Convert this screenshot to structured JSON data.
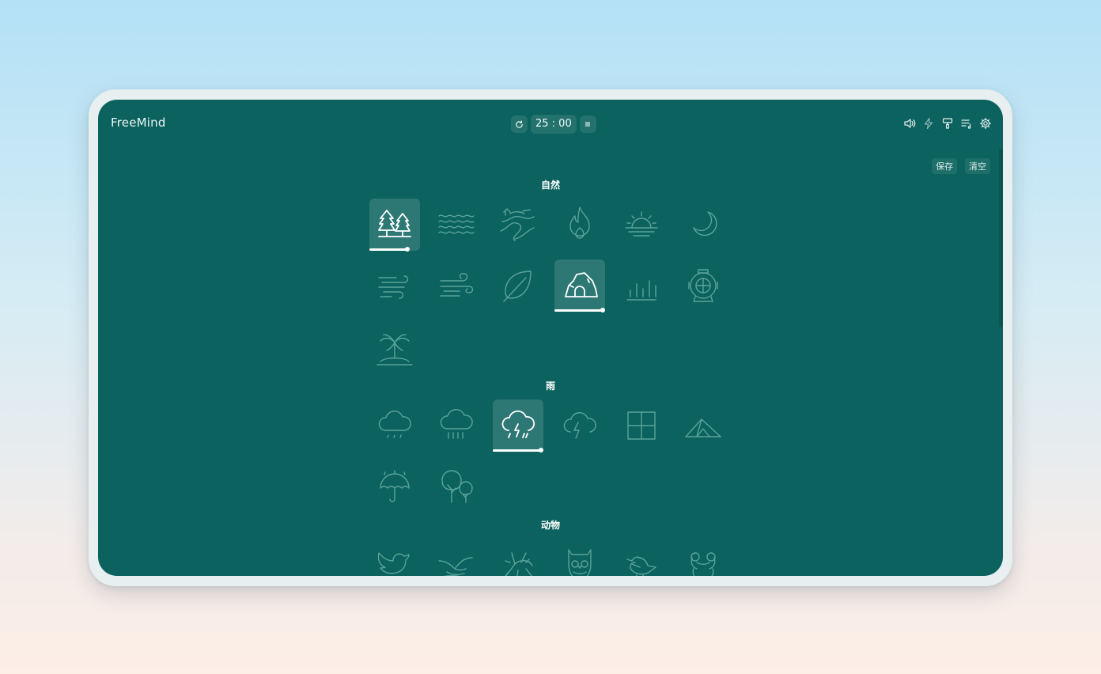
{
  "app": {
    "title": "FreeMind"
  },
  "timer": {
    "display": "25 : 00"
  },
  "actions": {
    "save": "保存",
    "clear": "清空"
  },
  "sections": [
    {
      "title": "自然",
      "sounds": [
        {
          "icon": "forest-icon",
          "active": true,
          "volume": 0.75
        },
        {
          "icon": "waves-icon",
          "active": false
        },
        {
          "icon": "river-icon",
          "active": false
        },
        {
          "icon": "fire-icon",
          "active": false
        },
        {
          "icon": "sunset-icon",
          "active": false
        },
        {
          "icon": "moon-icon",
          "active": false
        },
        {
          "icon": "breeze-icon",
          "active": false
        },
        {
          "icon": "wind-icon",
          "active": false
        },
        {
          "icon": "leaf-icon",
          "active": false
        },
        {
          "icon": "cave-icon",
          "active": true,
          "volume": 0.95
        },
        {
          "icon": "drips-icon",
          "active": false
        },
        {
          "icon": "diving-helmet-icon",
          "active": false
        },
        {
          "icon": "island-icon",
          "active": false
        }
      ]
    },
    {
      "title": "雨",
      "sounds": [
        {
          "icon": "light-rain-icon",
          "active": false
        },
        {
          "icon": "heavy-rain-icon",
          "active": false
        },
        {
          "icon": "thunderstorm-icon",
          "active": true,
          "volume": 0.95
        },
        {
          "icon": "thunder-icon",
          "active": false
        },
        {
          "icon": "window-icon",
          "active": false
        },
        {
          "icon": "tent-icon",
          "active": false
        },
        {
          "icon": "umbrella-icon",
          "active": false
        },
        {
          "icon": "rain-on-trees-icon",
          "active": false
        }
      ]
    },
    {
      "title": "动物",
      "sounds": [
        {
          "icon": "bird-icon",
          "active": false
        },
        {
          "icon": "seagull-icon",
          "active": false
        },
        {
          "icon": "cricket-icon",
          "active": false
        },
        {
          "icon": "owl-icon",
          "active": false
        },
        {
          "icon": "songbird-icon",
          "active": false
        },
        {
          "icon": "frog-icon",
          "active": false
        }
      ]
    }
  ]
}
